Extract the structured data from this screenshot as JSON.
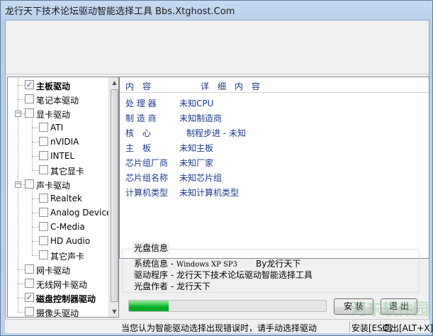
{
  "window": {
    "title": "龙行天下技术论坛驱动智能选择工具 Bbs.Xtghost.Com"
  },
  "tree": {
    "items": [
      {
        "label": "主板驱动",
        "checked": true,
        "bold": true
      },
      {
        "label": "笔记本驱动",
        "checked": false,
        "bold": false
      },
      {
        "label": "显卡驱动",
        "checked": false,
        "bold": false
      },
      {
        "label": "ATI",
        "checked": false,
        "bold": false
      },
      {
        "label": "nVIDIA",
        "checked": false,
        "bold": false
      },
      {
        "label": "INTEL",
        "checked": false,
        "bold": false
      },
      {
        "label": "其它显卡",
        "checked": false,
        "bold": false
      },
      {
        "label": "声卡驱动",
        "checked": false,
        "bold": false
      },
      {
        "label": "Realtek",
        "checked": false,
        "bold": false
      },
      {
        "label": "Analog Device",
        "checked": false,
        "bold": false
      },
      {
        "label": "C-Media",
        "checked": false,
        "bold": false
      },
      {
        "label": "HD Audio",
        "checked": false,
        "bold": false
      },
      {
        "label": "其它声卡",
        "checked": false,
        "bold": false
      },
      {
        "label": "网卡驱动",
        "checked": false,
        "bold": false
      },
      {
        "label": "无线网卡驱动",
        "checked": false,
        "bold": false
      },
      {
        "label": "磁盘控制器驱动",
        "checked": true,
        "bold": true
      },
      {
        "label": "摄像头驱动",
        "checked": false,
        "bold": false
      }
    ]
  },
  "details": {
    "header_content": "内　容",
    "header_detail": "详　细　内　容",
    "rows": [
      {
        "key": "处 理 器",
        "value": "未知CPU"
      },
      {
        "key": "制 造 商",
        "value": "未知制造商"
      },
      {
        "key": "核　心",
        "value": "制程步进 - 未知"
      },
      {
        "key": "主　板",
        "value": "未知主板"
      },
      {
        "key": "芯片组厂商",
        "value": "未知厂家"
      },
      {
        "key": "芯片组名称",
        "value": "未知芯片组"
      },
      {
        "key": "计算机类型",
        "value": "未知计算机类型"
      }
    ]
  },
  "disc_info": {
    "title": "光盘信息",
    "line1_label": "系统信息 - ",
    "line1_value": "Windows XP SP3",
    "line1_by": "By龙行天下",
    "line2": "驱动程序 - 龙行天下技术论坛驱动智能选择工具",
    "line3": "光盘作者 - 龙行天下"
  },
  "progress": {
    "value": 0.2
  },
  "buttons": {
    "install": "安 装",
    "exit": "退 出"
  },
  "status": {
    "message": "当您认为智能驱动选择出现错误时，请手动选择驱动",
    "install_hint": "安装[ESC]",
    "exit_hint": "退出[ALT+X]"
  },
  "watermark": "河东软件园",
  "colors": {
    "detail_text": "#1a3a8a",
    "progress_fill": "#06b025"
  }
}
